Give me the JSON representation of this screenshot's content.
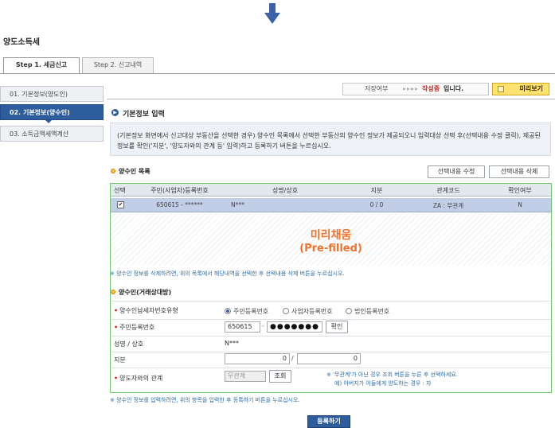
{
  "page": {
    "title": "양도소득세"
  },
  "tabs": [
    {
      "label": "Step 1. 세금신고",
      "active": true
    },
    {
      "label": "Step 2. 신고내역",
      "active": false
    }
  ],
  "sidebar": {
    "items": [
      {
        "label": "01. 기본정보(양도인)",
        "active": false
      },
      {
        "label": "02. 기본정보(양수인)",
        "active": true
      },
      {
        "label": "03. 소득금액세액계산",
        "active": false
      }
    ]
  },
  "status": {
    "label": "저장여부",
    "arrows": "▸▸▸▸",
    "value": "작성중",
    "suffix": "입니다.",
    "preview_label": "미리보기"
  },
  "section": {
    "title": "기본정보 입력",
    "info": "(기본정보 화면에서 신고대상 부동산을 선택한 경우) 양수인 목록에서 선택한 부동산의 양수인 정보가 제공되오니 입력대상 선택 후(선택내용 수정 클릭), 제공된 정보를 확인('지분', '양도자와의 관계 등' 입력)하고 등록하기 버튼을 누르십시오."
  },
  "buyer_list": {
    "title": "양수인 목록",
    "edit_button": "선택내용 수정",
    "delete_button": "선택내용 삭제",
    "columns": [
      "선택",
      "주민(사업자)등록번호",
      "성명/상호",
      "지분",
      "관계코드",
      "확인여부"
    ],
    "rows": [
      {
        "checked": "✔",
        "id_number": "650615 - ******",
        "name": "N***",
        "share": "0 / 0",
        "relation": "ZA : 무관계",
        "confirmed": "N"
      }
    ]
  },
  "prefilled": {
    "korean": "미리채움",
    "english": "(Pre-filled)"
  },
  "notes": {
    "delete_note": "※ 양수인 정보를 삭제하려면, 위의 목록에서 해당내역을 선택한 후 선택내용 삭제 버튼을 누르십시오.",
    "register_note": "※ 양수인 정보를 입력하려면, 위의 항목을 입력한 후 등록하기 버튼을 누르십시오."
  },
  "form": {
    "title": "양수인(거래상대방)",
    "type_label": "양수인납세자번호유형",
    "type_options": [
      "주민등록번호",
      "사업자등록번호",
      "법인등록번호"
    ],
    "id_label": "주민등록번호",
    "id_front": "650615",
    "id_dash": "-",
    "id_back_masked": "●●●●●●●",
    "confirm_button": "확인",
    "name_label": "성명 / 상호",
    "name_value": "N***",
    "share_label": "지분",
    "share_numerator": "0",
    "share_slash": "/",
    "share_denominator": "0",
    "relation_label": "양도자와의 관계",
    "relation_value": "무관계",
    "lookup_button": "조회",
    "relation_hint_1": "※ '무관계'가 아닌 경우 조회 버튼을 누른 후 선택하세요.",
    "relation_hint_2": "예) 아버지가 아들에게 양도하는 경우 : 자"
  },
  "register_button": "등록하기",
  "colors": {
    "accent": "#2e5d9d",
    "status_red": "#d0281e",
    "prefilled_orange": "#f0722b",
    "frame_green": "#6fc96f"
  }
}
